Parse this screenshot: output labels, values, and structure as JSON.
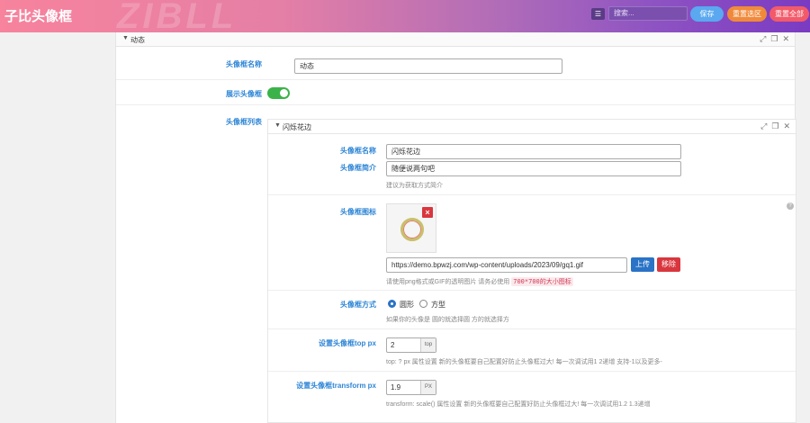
{
  "header": {
    "brand": "子比头像框",
    "watermark": "ZIBLL",
    "search_placeholder": "搜索...",
    "save_label": "保存",
    "reset_section_label": "重置选区",
    "reset_all_label": "重置全部",
    "gradient_colors": [
      "#f7839d",
      "#b06cb8",
      "#7a3bc2"
    ]
  },
  "panel": {
    "title": "动态",
    "fields": {
      "name_label": "头像框名称",
      "name_value": "动态",
      "show_label": "展示头像框",
      "show_enabled": true,
      "list_label": "头像框列表"
    }
  },
  "group": {
    "title": "闪烁花边",
    "name_label": "头像框名称",
    "name_value": "闪烁花边",
    "intro_label": "头像框简介",
    "intro_value": "随便说两句吧",
    "intro_hint": "建议为获取方式简介",
    "icon_label": "头像框图标",
    "icon_url": "https://demo.bpwzj.com/wp-content/uploads/2023/09/gq1.gif",
    "upload_label": "上传",
    "remove_label": "移除",
    "icon_hint": "请使用png格式或GIF的透明图片 请务必使用",
    "icon_hint_code": "700*700的大小图标",
    "shape_label": "头像框方式",
    "shape_options": [
      "圆形",
      "方型"
    ],
    "shape_selected": "圆形",
    "shape_hint": "如果你的头像是 圆的就选择圆 方的就选择方",
    "top_label": "设置头像框top px",
    "top_value": "2",
    "top_unit": "top",
    "top_hint": "top: ? px 属性设置 新的头像框要自己配置好防止头像框过大! 每一次调试用1 2递增 支持-1以及更多-",
    "transform_label": "设置头像框transform px",
    "transform_value": "1.9",
    "transform_unit": "PX",
    "transform_hint": "transform: scale() 属性设置 新的头像框要自己配置好防止头像框过大! 每一次调试用1.2 1.3递增"
  },
  "colors": {
    "label_blue": "#2f86d6",
    "toggle_green": "#3bb34a",
    "danger_red": "#d9363e",
    "primary_blue": "#2a73c6"
  }
}
